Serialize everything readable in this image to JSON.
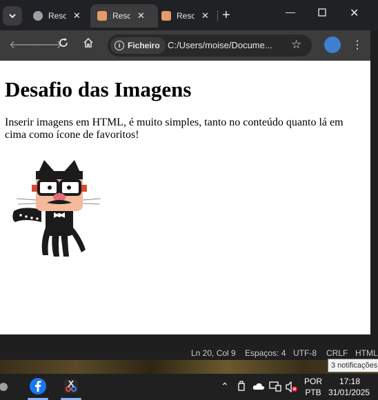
{
  "browser": {
    "tabs": [
      {
        "title": "Resources"
      },
      {
        "title": "Resources"
      },
      {
        "title": "Resources"
      }
    ],
    "security_chip": "Ficheiro",
    "url": "C:/Users/moise/Docume..."
  },
  "page": {
    "heading": "Desafio das Imagens",
    "paragraph": "Inserir imagens em HTML, é muito simples, tanto no conteúdo quanto lá em cima como ícone de favoritos!"
  },
  "editor_status": {
    "position": "Ln 20, Col 9",
    "spaces": "Espaços: 4",
    "encoding": "UTF-8",
    "eol": "CRLF",
    "language": "HTML",
    "notification": "3 notificações"
  },
  "taskbar": {
    "lang_top": "POR",
    "lang_bottom": "PTB",
    "time": "17:18",
    "date": "31/01/2025"
  },
  "colors": {
    "chrome_dark": "#202124",
    "toolbar": "#3c3c3c",
    "page_bg": "#ffffff",
    "taskbar": "#202020",
    "facebook_blue": "#1877f2"
  }
}
